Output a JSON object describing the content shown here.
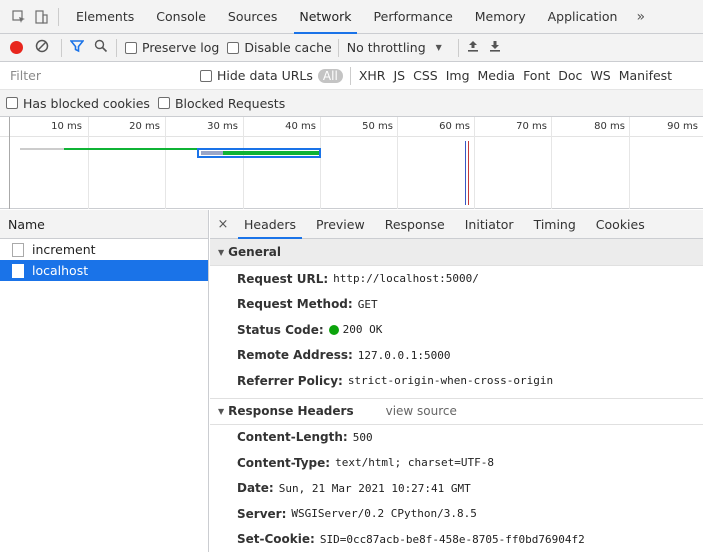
{
  "tabs": [
    "Elements",
    "Console",
    "Sources",
    "Network",
    "Performance",
    "Memory",
    "Application"
  ],
  "more_label": "»",
  "toolbar": {
    "preserve_log": "Preserve log",
    "disable_cache": "Disable cache",
    "throttling": "No throttling",
    "dropdown_arrow": "▼"
  },
  "filter": {
    "placeholder": "Filter",
    "hide_data_urls": "Hide data URLs",
    "types": [
      "All",
      "XHR",
      "JS",
      "CSS",
      "Img",
      "Media",
      "Font",
      "Doc",
      "WS",
      "Manifest"
    ]
  },
  "blocked": {
    "has_blocked_cookies": "Has blocked cookies",
    "blocked_requests": "Blocked Requests"
  },
  "timeline": {
    "ticks": [
      "10 ms",
      "20 ms",
      "30 ms",
      "40 ms",
      "50 ms",
      "60 ms",
      "70 ms",
      "80 ms",
      "90 ms"
    ]
  },
  "requests": {
    "header": "Name",
    "items": [
      "increment",
      "localhost"
    ],
    "selected": "localhost"
  },
  "detail_tabs": [
    "Headers",
    "Preview",
    "Response",
    "Initiator",
    "Timing",
    "Cookies"
  ],
  "general": {
    "title": "General",
    "rows": [
      {
        "key": "Request URL:",
        "value": "http://localhost:5000/"
      },
      {
        "key": "Request Method:",
        "value": "GET"
      },
      {
        "key": "Status Code:",
        "value": "200 OK"
      },
      {
        "key": "Remote Address:",
        "value": "127.0.0.1:5000"
      },
      {
        "key": "Referrer Policy:",
        "value": "strict-origin-when-cross-origin"
      }
    ]
  },
  "response_headers": {
    "title": "Response Headers",
    "view_source": "view source",
    "rows": [
      {
        "key": "Content-Length:",
        "value": "500"
      },
      {
        "key": "Content-Type:",
        "value": "text/html; charset=UTF-8"
      },
      {
        "key": "Date:",
        "value": "Sun, 21 Mar 2021 10:27:41 GMT"
      },
      {
        "key": "Server:",
        "value": "WSGIServer/0.2 CPython/3.8.5"
      },
      {
        "key": "Set-Cookie:",
        "value": "SID=0cc87acb-be8f-458e-8705-ff0bd76904f2"
      }
    ]
  },
  "colors": {
    "accent": "#1a73e8",
    "record": "#e8261d",
    "status_ok": "#0ca40c",
    "waterfall_green": "#0fb335"
  }
}
